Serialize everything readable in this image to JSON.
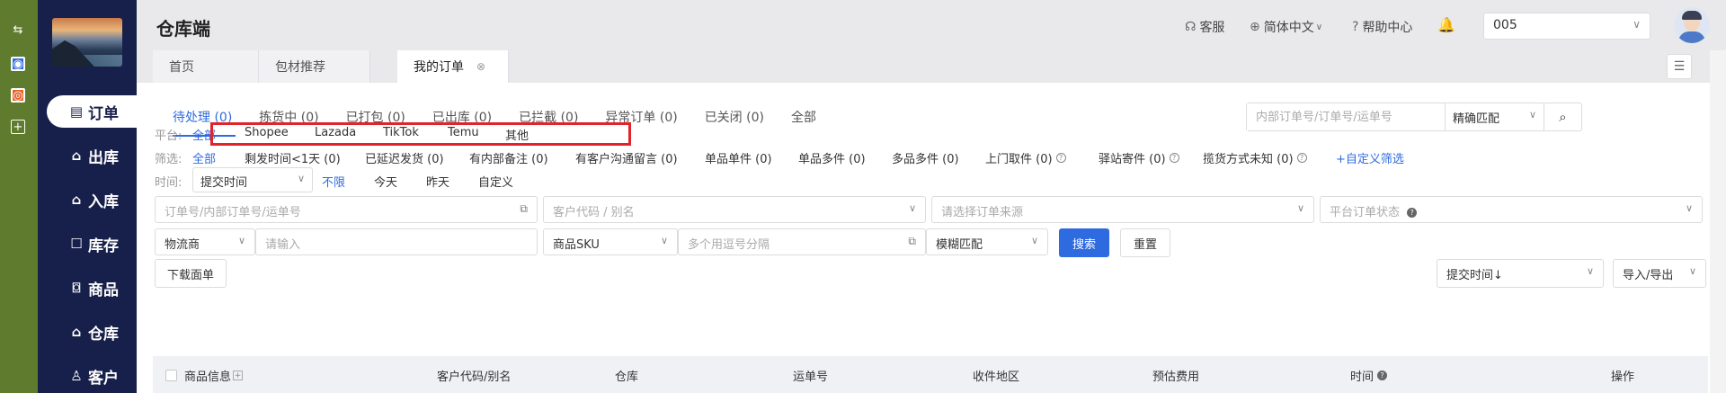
{
  "app": {
    "title": "仓库端"
  },
  "header": {
    "service_label": "客服",
    "language_label": "简体中文",
    "help_label": "帮助中心",
    "store_select_value": "005"
  },
  "sidebar": {
    "items": [
      {
        "label": "订单",
        "icon": "order-icon",
        "active": true
      },
      {
        "label": "出库",
        "icon": "outbound-icon"
      },
      {
        "label": "入库",
        "icon": "inbound-icon"
      },
      {
        "label": "库存",
        "icon": "inventory-icon"
      },
      {
        "label": "商品",
        "icon": "product-icon"
      },
      {
        "label": "仓库",
        "icon": "warehouse-icon"
      },
      {
        "label": "客户",
        "icon": "customer-icon"
      }
    ]
  },
  "tabs": [
    {
      "label": "首页"
    },
    {
      "label": "包材推荐"
    },
    {
      "label": "我的订单",
      "active": true
    }
  ],
  "status_tabs": [
    {
      "label": "待处理 (0)",
      "active": true
    },
    {
      "label": "拣货中 (0)"
    },
    {
      "label": "已打包 (0)"
    },
    {
      "label": "已出库 (0)"
    },
    {
      "label": "已拦截 (0)"
    },
    {
      "label": "异常订单 (0)"
    },
    {
      "label": "已关闭 (0)"
    },
    {
      "label": "全部"
    }
  ],
  "search": {
    "placeholder": "内部订单号/订单号/运单号",
    "match_mode": "精确匹配"
  },
  "platform_filter": {
    "label": "平台:",
    "options": [
      "全部",
      "Shopee",
      "Lazada",
      "TikTok",
      "Temu",
      "其他"
    ]
  },
  "screen_filter": {
    "label": "筛选:",
    "all": "全部",
    "options": [
      "剩发时间<1天 (0)",
      "已延迟发货 (0)",
      "有内部备注 (0)",
      "有客户沟通留言 (0)",
      "单品单件 (0)",
      "单品多件 (0)",
      "多品多件 (0)",
      "上门取件 (0)",
      "驿站寄件 (0)",
      "揽货方式未知 (0)"
    ],
    "custom": "+自定义筛选"
  },
  "time_filter": {
    "label": "时间:",
    "select_value": "提交时间",
    "options": [
      "不限",
      "今天",
      "昨天",
      "自定义"
    ]
  },
  "fields": {
    "order_no_placeholder": "订单号/内部订单号/运单号",
    "customer_placeholder": "客户代码 / 别名",
    "source_placeholder": "请选择订单来源",
    "platform_status_placeholder": "平台订单状态",
    "carrier_label": "物流商",
    "carrier_input_placeholder": "请输入",
    "sku_label": "商品SKU",
    "sku_input_placeholder": "多个用逗号分隔",
    "fuzzy_label": "模糊匹配"
  },
  "buttons": {
    "search": "搜索",
    "reset": "重置",
    "download_label": "下载面单",
    "sort_select": "提交时间↓",
    "import_export": "导入/导出"
  },
  "table": {
    "columns": [
      "商品信息",
      "客户代码/别名",
      "仓库",
      "运单号",
      "收件地区",
      "预估费用",
      "时间",
      "操作"
    ]
  },
  "colors": {
    "primary": "#2f6be0",
    "sidebar": "#17204a",
    "outer_rail": "#5f7b2e",
    "highlight": "#e0242a"
  }
}
